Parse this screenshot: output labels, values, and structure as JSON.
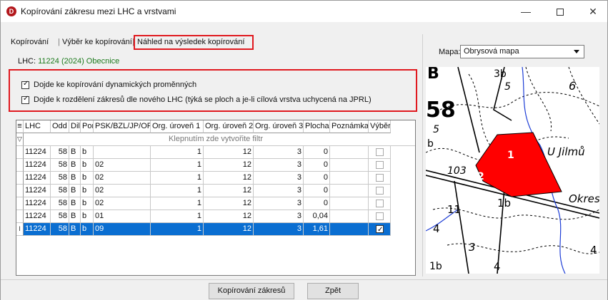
{
  "window": {
    "title": "Kopírování zákresu mezi LHC a vrstvami",
    "app_icon_letter": "D",
    "min_symbol": "—",
    "close_symbol": "✕"
  },
  "tabs": [
    {
      "label": "Kopírování"
    },
    {
      "label": "Výběr ke kopírování"
    },
    {
      "label": "Náhled na výsledek kopírování",
      "active": true
    }
  ],
  "lhc": {
    "label": "LHC:",
    "value": "11224 (2024) Obecnice"
  },
  "options": [
    {
      "label": "Dojde ke kopírování dynamických proměnných",
      "checked": true
    },
    {
      "label": "Dojde k rozdělení zákresů dle nového LHC (týká se ploch a je-li cílová vrstva uchycená na JPRL)",
      "checked": true
    }
  ],
  "grid": {
    "header_icon": "≡",
    "columns": [
      "LHC",
      "Odd",
      "Dil",
      "Por",
      "PSK/BZL/JP/OP",
      "Org. úroveň 1",
      "Org. úroveň 2",
      "Org. úroveň 3",
      "Plocha",
      "Poznámka",
      "Výběr"
    ],
    "filter_icon": "▽",
    "filter_placeholder": "Klepnutím zde vytvořite filtr",
    "rows": [
      {
        "lhc": "11224",
        "odd": "58",
        "dil": "B",
        "por": "b",
        "psk": "",
        "o1": "1",
        "o2": "12",
        "o3": "3",
        "plocha": "0",
        "poznamka": "",
        "vyber": false,
        "selected": false
      },
      {
        "lhc": "11224",
        "odd": "58",
        "dil": "B",
        "por": "b",
        "psk": "02",
        "o1": "1",
        "o2": "12",
        "o3": "3",
        "plocha": "0",
        "poznamka": "",
        "vyber": false,
        "selected": false
      },
      {
        "lhc": "11224",
        "odd": "58",
        "dil": "B",
        "por": "b",
        "psk": "02",
        "o1": "1",
        "o2": "12",
        "o3": "3",
        "plocha": "0",
        "poznamka": "",
        "vyber": false,
        "selected": false
      },
      {
        "lhc": "11224",
        "odd": "58",
        "dil": "B",
        "por": "b",
        "psk": "02",
        "o1": "1",
        "o2": "12",
        "o3": "3",
        "plocha": "0",
        "poznamka": "",
        "vyber": false,
        "selected": false
      },
      {
        "lhc": "11224",
        "odd": "58",
        "dil": "B",
        "por": "b",
        "psk": "02",
        "o1": "1",
        "o2": "12",
        "o3": "3",
        "plocha": "0",
        "poznamka": "",
        "vyber": false,
        "selected": false
      },
      {
        "lhc": "11224",
        "odd": "58",
        "dil": "B",
        "por": "b",
        "psk": "01",
        "o1": "1",
        "o2": "12",
        "o3": "3",
        "plocha": "0,04",
        "poznamka": "",
        "vyber": false,
        "selected": false
      },
      {
        "lhc": "11224",
        "odd": "58",
        "dil": "B",
        "por": "b",
        "psk": "09",
        "o1": "1",
        "o2": "12",
        "o3": "3",
        "plocha": "1,61",
        "poznamka": "",
        "vyber": true,
        "selected": true
      }
    ],
    "cursor_glyph": "I"
  },
  "buttons": {
    "copy": "Kopírování zákresů",
    "back": "Zpět"
  },
  "map": {
    "label": "Mapa:",
    "selected_option": "Obrysová mapa",
    "labels": [
      "B",
      "3b",
      "6",
      "58",
      "5",
      "5",
      "b",
      "1",
      "U Jilmů",
      "103",
      "2",
      "1b",
      "11",
      "Okres",
      "4",
      "3",
      "1b",
      "4",
      "4"
    ],
    "highlight_color": "#ff0000"
  }
}
